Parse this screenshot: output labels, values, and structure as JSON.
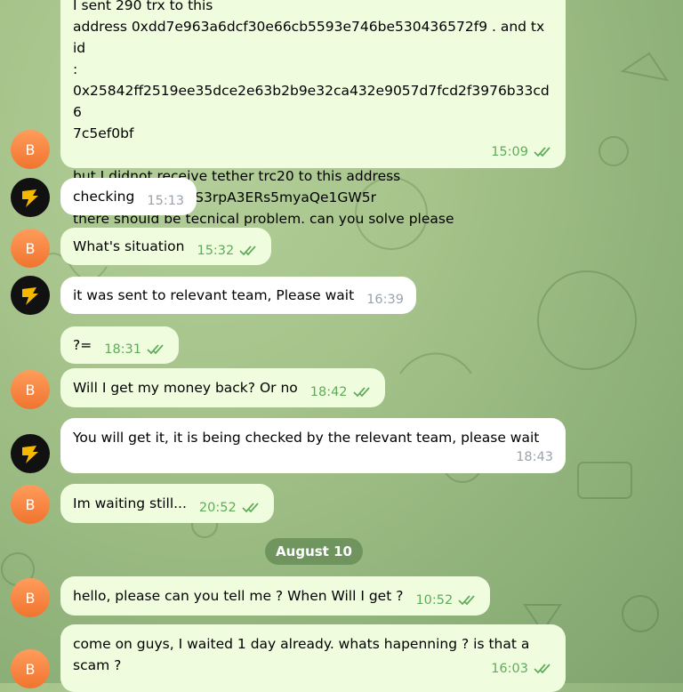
{
  "messages": [
    {
      "id": "m1",
      "sender_initial": "B",
      "text": "I sent 290 trx to this\naddress 0xdd7e963a6dcf30e66cb5593e746be530436572f9 . and tx id\n: 0x25842ff2519ee35dce2e63b2b9e32ca432e9057d7fcd2f3976b33cd6\n7c5ef0bf\n\nbut I didnot receive tether trc20 to this address\n. TAJAErC2NAYFAzS3rpA3ERs5myaQe1GW5r\nthere should be tecnical problem. can you solve please",
      "time": "15:09"
    },
    {
      "id": "m2",
      "text": "checking",
      "time": "15:13"
    },
    {
      "id": "m3",
      "sender_initial": "B",
      "text": "What's situation",
      "time": "15:32"
    },
    {
      "id": "m4",
      "text": "it was sent to relevant team, Please wait",
      "time": "16:39"
    },
    {
      "id": "m5",
      "text": "?=",
      "time": "18:31"
    },
    {
      "id": "m6",
      "sender_initial": "B",
      "text": "Will I get my money back? Or no",
      "time": "18:42"
    },
    {
      "id": "m7",
      "text": "You will get it, it is being checked by the relevant team, please wait",
      "time": "18:43"
    },
    {
      "id": "m8",
      "sender_initial": "B",
      "text": "Im waiting still...",
      "time": "20:52"
    },
    {
      "id": "m9",
      "sender_initial": "B",
      "text": "hello, please can you tell me ? When Will I get ?",
      "time": "10:52"
    },
    {
      "id": "m10",
      "sender_initial": "B",
      "text": "come on guys, I waited 1 day already. whats hapenning ? is that a\nscam ?",
      "time": "16:03"
    }
  ],
  "date_separator": "August 10",
  "colors": {
    "outgoing_bubble": "#effdde",
    "incoming_bubble": "#ffffff",
    "read_check": "#5fab5a",
    "avatar_user": "#f0742f",
    "avatar_bot": "#111111",
    "bot_logo": "#f5b800"
  },
  "icons": {
    "read_receipt": "double-check-icon",
    "bot_avatar": "lightning-logo-icon"
  }
}
